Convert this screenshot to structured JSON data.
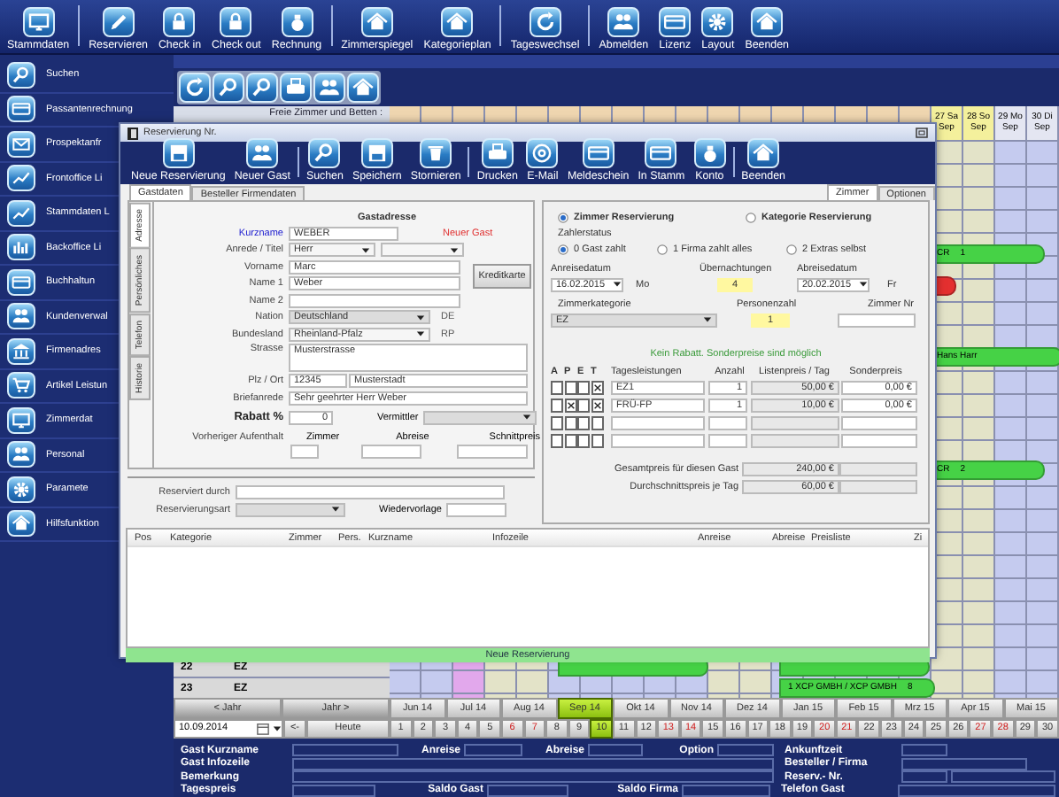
{
  "toolbar": [
    {
      "label": "Stammdaten",
      "group_end": true
    },
    {
      "label": "Reservieren",
      "group_end": false
    },
    {
      "label": "Check in",
      "group_end": false
    },
    {
      "label": "Check out",
      "group_end": false
    },
    {
      "label": "Rechnung",
      "group_end": true
    },
    {
      "label": "Zimmerspiegel",
      "group_end": false
    },
    {
      "label": "Kategorieplan",
      "group_end": true
    },
    {
      "label": "Tageswechsel",
      "group_end": true
    },
    {
      "label": "Abmelden",
      "group_end": false
    },
    {
      "label": "Lizenz",
      "group_end": false
    },
    {
      "label": "Layout",
      "group_end": false
    },
    {
      "label": "Beenden",
      "group_end": false
    }
  ],
  "sidebar": {
    "items": [
      {
        "label": "Suchen"
      },
      {
        "label": "Passantenrechnung"
      },
      {
        "label": "Prospektanfr"
      },
      {
        "label": "Frontoffice Li"
      },
      {
        "label": "Stammdaten L"
      },
      {
        "label": "Backoffice Li"
      },
      {
        "label": "Buchhaltun"
      },
      {
        "label": "Kundenverwal"
      },
      {
        "label": "Firmenadres"
      },
      {
        "label": "Artikel Leistun"
      },
      {
        "label": "Zimmerdat"
      },
      {
        "label": "Personal"
      },
      {
        "label": "Paramete"
      },
      {
        "label": "Hilfsfunktion"
      }
    ]
  },
  "calendar": {
    "caption": "Freie Zimmer und Betten :",
    "days": [
      {
        "color": "#c5cbef"
      },
      {
        "color": "#c5cbef"
      },
      {
        "color": "#e2a8ec"
      },
      {
        "color": "#e3e3c8"
      },
      {
        "color": "#e3e3c8"
      },
      {
        "color": "#c5cbef"
      },
      {
        "color": "#c5cbef"
      },
      {
        "color": "#c5cbef"
      },
      {
        "color": "#c5cbef"
      },
      {
        "color": "#c5cbef"
      },
      {
        "color": "#e3e3c8"
      },
      {
        "color": "#e3e3c8"
      },
      {
        "color": "#c5cbef"
      },
      {
        "color": "#c5cbef"
      },
      {
        "color": "#c5cbef"
      },
      {
        "color": "#c5cbef"
      },
      {
        "color": "#c5cbef"
      },
      {
        "color": "#e3e3c8",
        "label": "27 Sa",
        "month": "Sep",
        "header": {
          "color": "#f4f09c"
        }
      },
      {
        "color": "#e3e3c8",
        "label": "28 So",
        "month": "Sep",
        "header": {
          "color": "#f4f09c"
        }
      },
      {
        "color": "#c5cbef",
        "label": "29 Mo",
        "month": "Sep",
        "header": {
          "color": "#e4e6f2"
        }
      },
      {
        "color": "#c5cbef",
        "label": "30 Di",
        "month": "Sep",
        "header": {
          "color": "#e4e6f2"
        }
      }
    ],
    "rows": [
      {
        "number": "22",
        "category": "EZ"
      },
      {
        "number": "23",
        "category": "EZ"
      }
    ],
    "bookings": [
      {
        "name": "CR",
        "count": "1",
        "color": "#46d246"
      },
      {
        "color": "#e43030"
      },
      {
        "name": "Hans Harr",
        "color": "#46d246"
      },
      {
        "name": "CR",
        "count": "2",
        "color": "#46d246"
      },
      {
        "color": "#46d246"
      },
      {
        "color": "#46d246"
      },
      {
        "name": "1 XCP GMBH / XCP GMBH",
        "count": "8",
        "color": "#46d246"
      }
    ]
  },
  "navigation": {
    "year_back": "< Jahr",
    "year_forward": "Jahr >",
    "months": [
      {
        "label": "Jun 14",
        "selected": false
      },
      {
        "label": "Jul 14",
        "selected": false
      },
      {
        "label": "Aug 14",
        "selected": false
      },
      {
        "label": "Sep 14",
        "selected": true
      },
      {
        "label": "Okt 14",
        "selected": false
      },
      {
        "label": "Nov 14",
        "selected": false
      },
      {
        "label": "Dez 14",
        "selected": false
      },
      {
        "label": "Jan 15",
        "selected": false
      },
      {
        "label": "Feb 15",
        "selected": false
      },
      {
        "label": "Mrz 15",
        "selected": false
      },
      {
        "label": "Apr 15",
        "selected": false
      },
      {
        "label": "Mai 15",
        "selected": false
      }
    ],
    "date": "10.09.2014",
    "back": "<-",
    "today": "Heute",
    "days": [
      {
        "label": "1",
        "selected": false,
        "weekend": false
      },
      {
        "label": "2",
        "selected": false,
        "weekend": false
      },
      {
        "label": "3",
        "selected": false,
        "weekend": false
      },
      {
        "label": "4",
        "selected": false,
        "weekend": false
      },
      {
        "label": "5",
        "selected": false,
        "weekend": false
      },
      {
        "label": "6",
        "selected": false,
        "weekend": true
      },
      {
        "label": "7",
        "selected": false,
        "weekend": true
      },
      {
        "label": "8",
        "selected": false,
        "weekend": false
      },
      {
        "label": "9",
        "selected": false,
        "weekend": false
      },
      {
        "label": "10",
        "selected": true,
        "weekend": false
      },
      {
        "label": "11",
        "selected": false,
        "weekend": false
      },
      {
        "label": "12",
        "selected": false,
        "weekend": false
      },
      {
        "label": "13",
        "selected": false,
        "weekend": true
      },
      {
        "label": "14",
        "selected": false,
        "weekend": true
      },
      {
        "label": "15",
        "selected": false,
        "weekend": false
      },
      {
        "label": "16",
        "selected": false,
        "weekend": false
      },
      {
        "label": "17",
        "selected": false,
        "weekend": false
      },
      {
        "label": "18",
        "selected": false,
        "weekend": false
      },
      {
        "label": "19",
        "selected": false,
        "weekend": false
      },
      {
        "label": "20",
        "selected": false,
        "weekend": true
      },
      {
        "label": "21",
        "selected": false,
        "weekend": true
      },
      {
        "label": "22",
        "selected": false,
        "weekend": false
      },
      {
        "label": "23",
        "selected": false,
        "weekend": false
      },
      {
        "label": "24",
        "selected": false,
        "weekend": false
      },
      {
        "label": "25",
        "selected": false,
        "weekend": false
      },
      {
        "label": "26",
        "selected": false,
        "weekend": false
      },
      {
        "label": "27",
        "selected": false,
        "weekend": true
      },
      {
        "label": "28",
        "selected": false,
        "weekend": true
      },
      {
        "label": "29",
        "selected": false,
        "weekend": false
      },
      {
        "label": "30",
        "selected": false,
        "weekend": false
      }
    ]
  },
  "info": {
    "labels": [
      {
        "label": "Gast Kurzname"
      },
      {
        "label": "Anreise"
      },
      {
        "label": "Abreise"
      },
      {
        "label": "Option"
      },
      {
        "label": "Ankunftzeit"
      },
      {
        "label": "Gast Infozeile"
      },
      {
        "label": "Besteller /  Firma"
      },
      {
        "label": "Bemerkung"
      },
      {
        "label": "Reserv.- Nr."
      },
      {
        "label": "Tagespreis"
      },
      {
        "label": "Saldo Gast"
      },
      {
        "label": "Saldo  Firma"
      },
      {
        "label": "Telefon Gast"
      }
    ]
  },
  "dialog": {
    "title": "Reservierung Nr.",
    "toolbar": [
      {
        "label": "Neue Reservierung",
        "group_end": false
      },
      {
        "label": "Neuer Gast",
        "group_end": true
      },
      {
        "label": "Suchen",
        "group_end": false
      },
      {
        "label": "Speichern",
        "group_end": false
      },
      {
        "label": "Stornieren",
        "group_end": true
      },
      {
        "label": "Drucken",
        "group_end": false
      },
      {
        "label": "E-Mail",
        "group_end": false
      },
      {
        "label": "Meldeschein",
        "group_end": false
      },
      {
        "label": "In Stamm",
        "group_end": false
      },
      {
        "label": "Konto",
        "group_end": true
      },
      {
        "label": "Beenden",
        "group_end": false
      }
    ],
    "left_tabs": [
      {
        "label": "Gastdaten",
        "selected": true
      },
      {
        "label": "Besteller Firmendaten",
        "selected": false
      }
    ],
    "right_tabs": [
      {
        "label": "Zimmer",
        "selected": true
      },
      {
        "label": "Optionen",
        "selected": false
      }
    ],
    "side_tabs": [
      {
        "label": "Adresse",
        "selected": true
      },
      {
        "label": "Persönliches",
        "selected": false
      },
      {
        "label": "Telefon",
        "selected": false
      },
      {
        "label": "Historie",
        "selected": false
      }
    ],
    "guest": {
      "heading": "Gastadresse",
      "short_name_label": "Kurzname",
      "short_name": "WEBER",
      "new_guest": "Neuer Gast",
      "salutation_label": "Anrede / Titel",
      "salutation": "Herr",
      "first_name_label": "Vorname",
      "first_name": "Marc",
      "name1_label": "Name 1",
      "name1": "Weber",
      "name2_label": "Name 2",
      "credit_card_button": "Kreditkarte",
      "nation_label": "Nation",
      "nation": "Deutschland",
      "nation_code": "DE",
      "state_label": "Bundesland",
      "state": "Rheinland-Pfalz",
      "state_code": "RP",
      "street_label": "Strasse",
      "street": "Musterstrasse",
      "city_label": "Plz / Ort",
      "zip": "12345",
      "city": "Musterstadt",
      "letter_label": "Briefanrede",
      "letter": "Sehr geehrter Herr Weber",
      "discount_label": "Rabatt %",
      "discount": "0",
      "agent_label": "Vermittler",
      "previous_label": "Vorheriger Aufenthalt",
      "previous_room_label": "Zimmer",
      "previous_departure_label": "Abreise",
      "previous_price_label": "Schnittpreis",
      "reserved_by_label": "Reserviert  durch",
      "type_label": "Reservierungsart",
      "followup_label": "Wiedervorlage"
    },
    "booking_mode": [
      {
        "label": "Zimmer Reservierung",
        "selected": true
      },
      {
        "label": "Kategorie Reservierung",
        "selected": false
      }
    ],
    "payer_label": "Zahlerstatus",
    "payer": [
      {
        "label": "0 Gast zahlt",
        "selected": true
      },
      {
        "label": "1 Firma zahlt alles",
        "selected": false
      },
      {
        "label": "2 Extras selbst",
        "selected": false
      }
    ],
    "arrival_label": "Anreisedatum",
    "arrival": "16.02.2015",
    "arrival_day": "Mo",
    "nights_label": "Übernachtungen",
    "nights": "4",
    "departure_label": "Abreisedatum",
    "departure": "20.02.2015",
    "departure_day": "Fr",
    "category_label": "Zimmerkategorie",
    "category": "EZ",
    "persons_label": "Personenzahl",
    "persons": "1",
    "room_label": "Zimmer Nr",
    "discount_note": "Kein Rabatt. Sonderpreise sind möglich",
    "services": {
      "flag_headers": [
        "A",
        "P",
        "E",
        "T"
      ],
      "columns": [
        "Tagesleistungen",
        "Anzahl",
        "Listenpreis / Tag",
        "Sonderpreis"
      ],
      "rows": [
        {
          "flags": [
            false,
            false,
            false,
            true
          ],
          "service": "EZ1",
          "count": "1",
          "list_price": "50,00 €",
          "special_price": "0,00 €"
        },
        {
          "flags": [
            false,
            true,
            false,
            true
          ],
          "service": "FRÜ-FP",
          "count": "1",
          "list_price": "10,00 €",
          "special_price": "0,00 €"
        },
        {
          "flags": [
            false,
            false,
            false,
            false
          ]
        },
        {
          "flags": [
            false,
            false,
            false,
            false
          ]
        }
      ]
    },
    "total_label": "Gesamtpreis für diesen Gast",
    "total": "240,00 €",
    "average_label": "Durchschnittspreis je Tag",
    "average": "60,00 €",
    "list_columns": [
      "Pos",
      "Kategorie",
      "Zimmer",
      "Pers.",
      "Kurzname",
      "Infozeile",
      "Anreise",
      "Abreise",
      "Preisliste",
      "Zi"
    ],
    "status": "Neue Reservierung"
  }
}
